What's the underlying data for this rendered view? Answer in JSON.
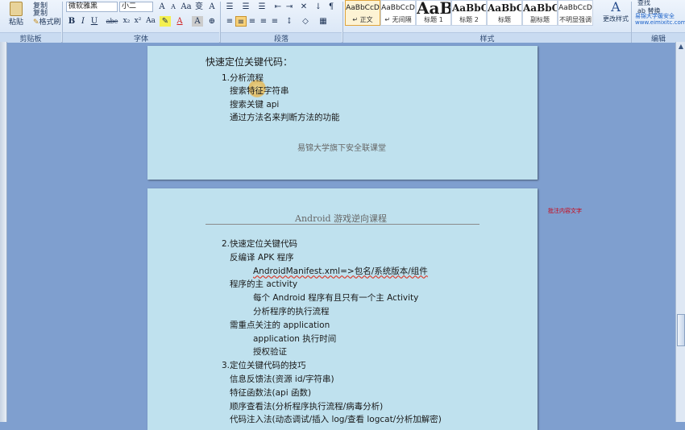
{
  "ribbon": {
    "clipboard": {
      "paste": "粘贴",
      "copy": "复制",
      "format_painter": "格式刷",
      "label": "剪贴板"
    },
    "font": {
      "name": "微软雅黑",
      "size": "小二",
      "label": "字体",
      "bold": "B",
      "italic": "I",
      "underline": "U",
      "strike": "abe",
      "sub": "x₂",
      "sup": "x²",
      "clear": "Aa",
      "grow": "A",
      "shrink": "A",
      "color_a": "A"
    },
    "paragraph": {
      "label": "段落"
    },
    "styles": {
      "label": "样式",
      "items": [
        {
          "preview": "AaBbCcD",
          "name": "↵ 正文"
        },
        {
          "preview": "AaBbCcD",
          "name": "↵ 无间隔"
        },
        {
          "preview": "AaB",
          "name": "标题 1"
        },
        {
          "preview": "AaBbC",
          "name": "标题 2"
        },
        {
          "preview": "AaBbC",
          "name": "标题"
        },
        {
          "preview": "AaBbC",
          "name": "副标题"
        },
        {
          "preview": "AaBbCcD",
          "name": "不明显强调"
        }
      ],
      "change": "更改样式"
    },
    "editing": {
      "find": "查找",
      "replace": "替换",
      "label": "编辑"
    },
    "watermark": "易锦大学媛安全",
    "watermark_url": "www.eimixitc.com"
  },
  "page1": {
    "heading": "快速定位关键代码：",
    "lines": [
      "1.分析流程",
      "搜索特征字符串",
      "搜索关键 api",
      "通过方法名来判断方法的功能"
    ],
    "footer": "易锦大学旗下安全联课堂"
  },
  "page2": {
    "header": "Android 游戏逆向课程",
    "lines": [
      "2.快速定位关键代码",
      "反编译 APK 程序",
      "AndroidManifest.xml=>包名/系统版本/组件",
      "程序的主 activity",
      "每个 Android 程序有且只有一个主 Activity",
      "分析程序的执行流程",
      "需重点关注的 application",
      "application 执行时间",
      "授权验证",
      "3.定位关键代码的技巧",
      "信息反馈法(资源 id/字符串)",
      "特征函数法(api 函数)",
      "顺序查看法(分析程序执行流程/病毒分析)",
      "代码注入法(动态调试/插入 log/查看 logcat/分析加解密)"
    ]
  },
  "side_note": "批注内容文字"
}
